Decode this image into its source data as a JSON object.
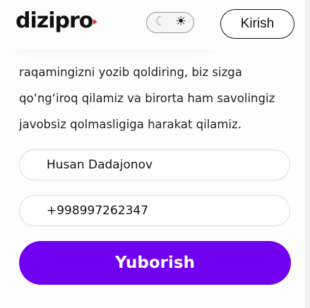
{
  "header": {
    "logo": "dizipro",
    "theme_toggle": {
      "options": [
        "moon-icon",
        "sun-icon"
      ],
      "selected": "light"
    },
    "login_label": "Kirish"
  },
  "form": {
    "description": "raqamingizni yozib qoldiring, biz sizga qo‘ng‘iroq qilamiz va birorta ham savolingiz javobsiz qolmasligiga harakat qilamiz.",
    "name_value": "Husan Dadajonov",
    "phone_value": "+998997262347",
    "submit_label": "Yuborish"
  },
  "colors": {
    "accent": "#7100f0",
    "logo_mark": "#e5322d"
  }
}
